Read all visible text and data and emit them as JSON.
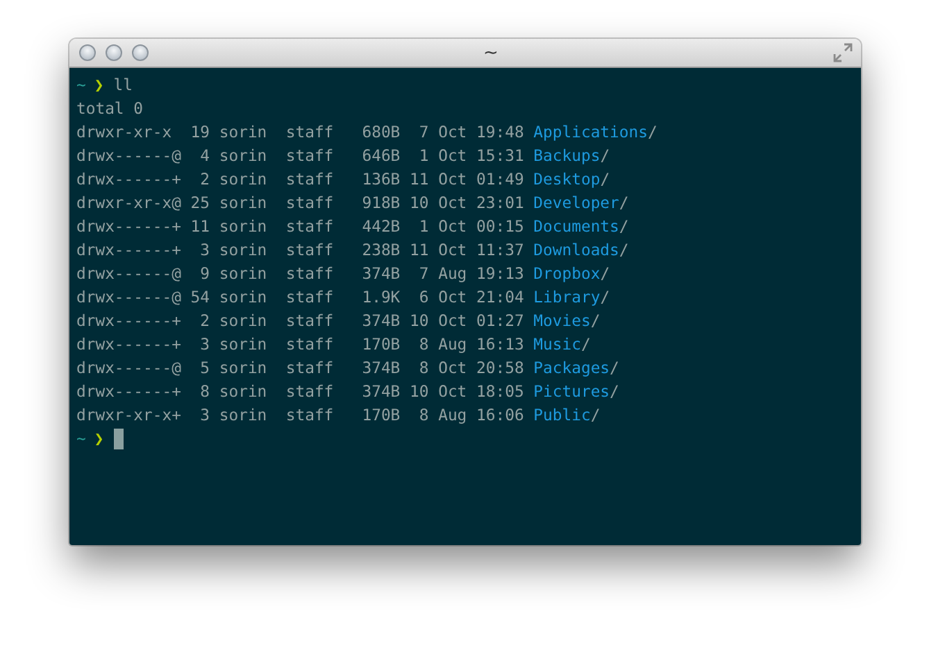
{
  "window": {
    "title": "~"
  },
  "terminal": {
    "lines": [
      {
        "kind": "prompt",
        "cwd": "~",
        "symbol": "❯",
        "command": "ll"
      },
      {
        "kind": "text",
        "text": "total 0"
      },
      {
        "kind": "entry",
        "info": "drwxr-xr-x  19 sorin  staff   680B  7 Oct 19:48 ",
        "name": "Applications",
        "suffix": "/"
      },
      {
        "kind": "entry",
        "info": "drwx------@  4 sorin  staff   646B  1 Oct 15:31 ",
        "name": "Backups",
        "suffix": "/"
      },
      {
        "kind": "entry",
        "info": "drwx------+  2 sorin  staff   136B 11 Oct 01:49 ",
        "name": "Desktop",
        "suffix": "/"
      },
      {
        "kind": "entry",
        "info": "drwxr-xr-x@ 25 sorin  staff   918B 10 Oct 23:01 ",
        "name": "Developer",
        "suffix": "/"
      },
      {
        "kind": "entry",
        "info": "drwx------+ 11 sorin  staff   442B  1 Oct 00:15 ",
        "name": "Documents",
        "suffix": "/"
      },
      {
        "kind": "entry",
        "info": "drwx------+  3 sorin  staff   238B 11 Oct 11:37 ",
        "name": "Downloads",
        "suffix": "/"
      },
      {
        "kind": "entry",
        "info": "drwx------@  9 sorin  staff   374B  7 Aug 19:13 ",
        "name": "Dropbox",
        "suffix": "/"
      },
      {
        "kind": "entry",
        "info": "drwx------@ 54 sorin  staff   1.9K  6 Oct 21:04 ",
        "name": "Library",
        "suffix": "/"
      },
      {
        "kind": "entry",
        "info": "drwx------+  2 sorin  staff   374B 10 Oct 01:27 ",
        "name": "Movies",
        "suffix": "/"
      },
      {
        "kind": "entry",
        "info": "drwx------+  3 sorin  staff   170B  8 Aug 16:13 ",
        "name": "Music",
        "suffix": "/"
      },
      {
        "kind": "entry",
        "info": "drwx------@  5 sorin  staff   374B  8 Oct 20:58 ",
        "name": "Packages",
        "suffix": "/"
      },
      {
        "kind": "entry",
        "info": "drwx------+  8 sorin  staff   374B 10 Oct 18:05 ",
        "name": "Pictures",
        "suffix": "/"
      },
      {
        "kind": "entry",
        "info": "drwxr-xr-x+  3 sorin  staff   170B  8 Aug 16:06 ",
        "name": "Public",
        "suffix": "/"
      },
      {
        "kind": "prompt",
        "cwd": "~",
        "symbol": "❯",
        "cursor": true
      }
    ]
  }
}
